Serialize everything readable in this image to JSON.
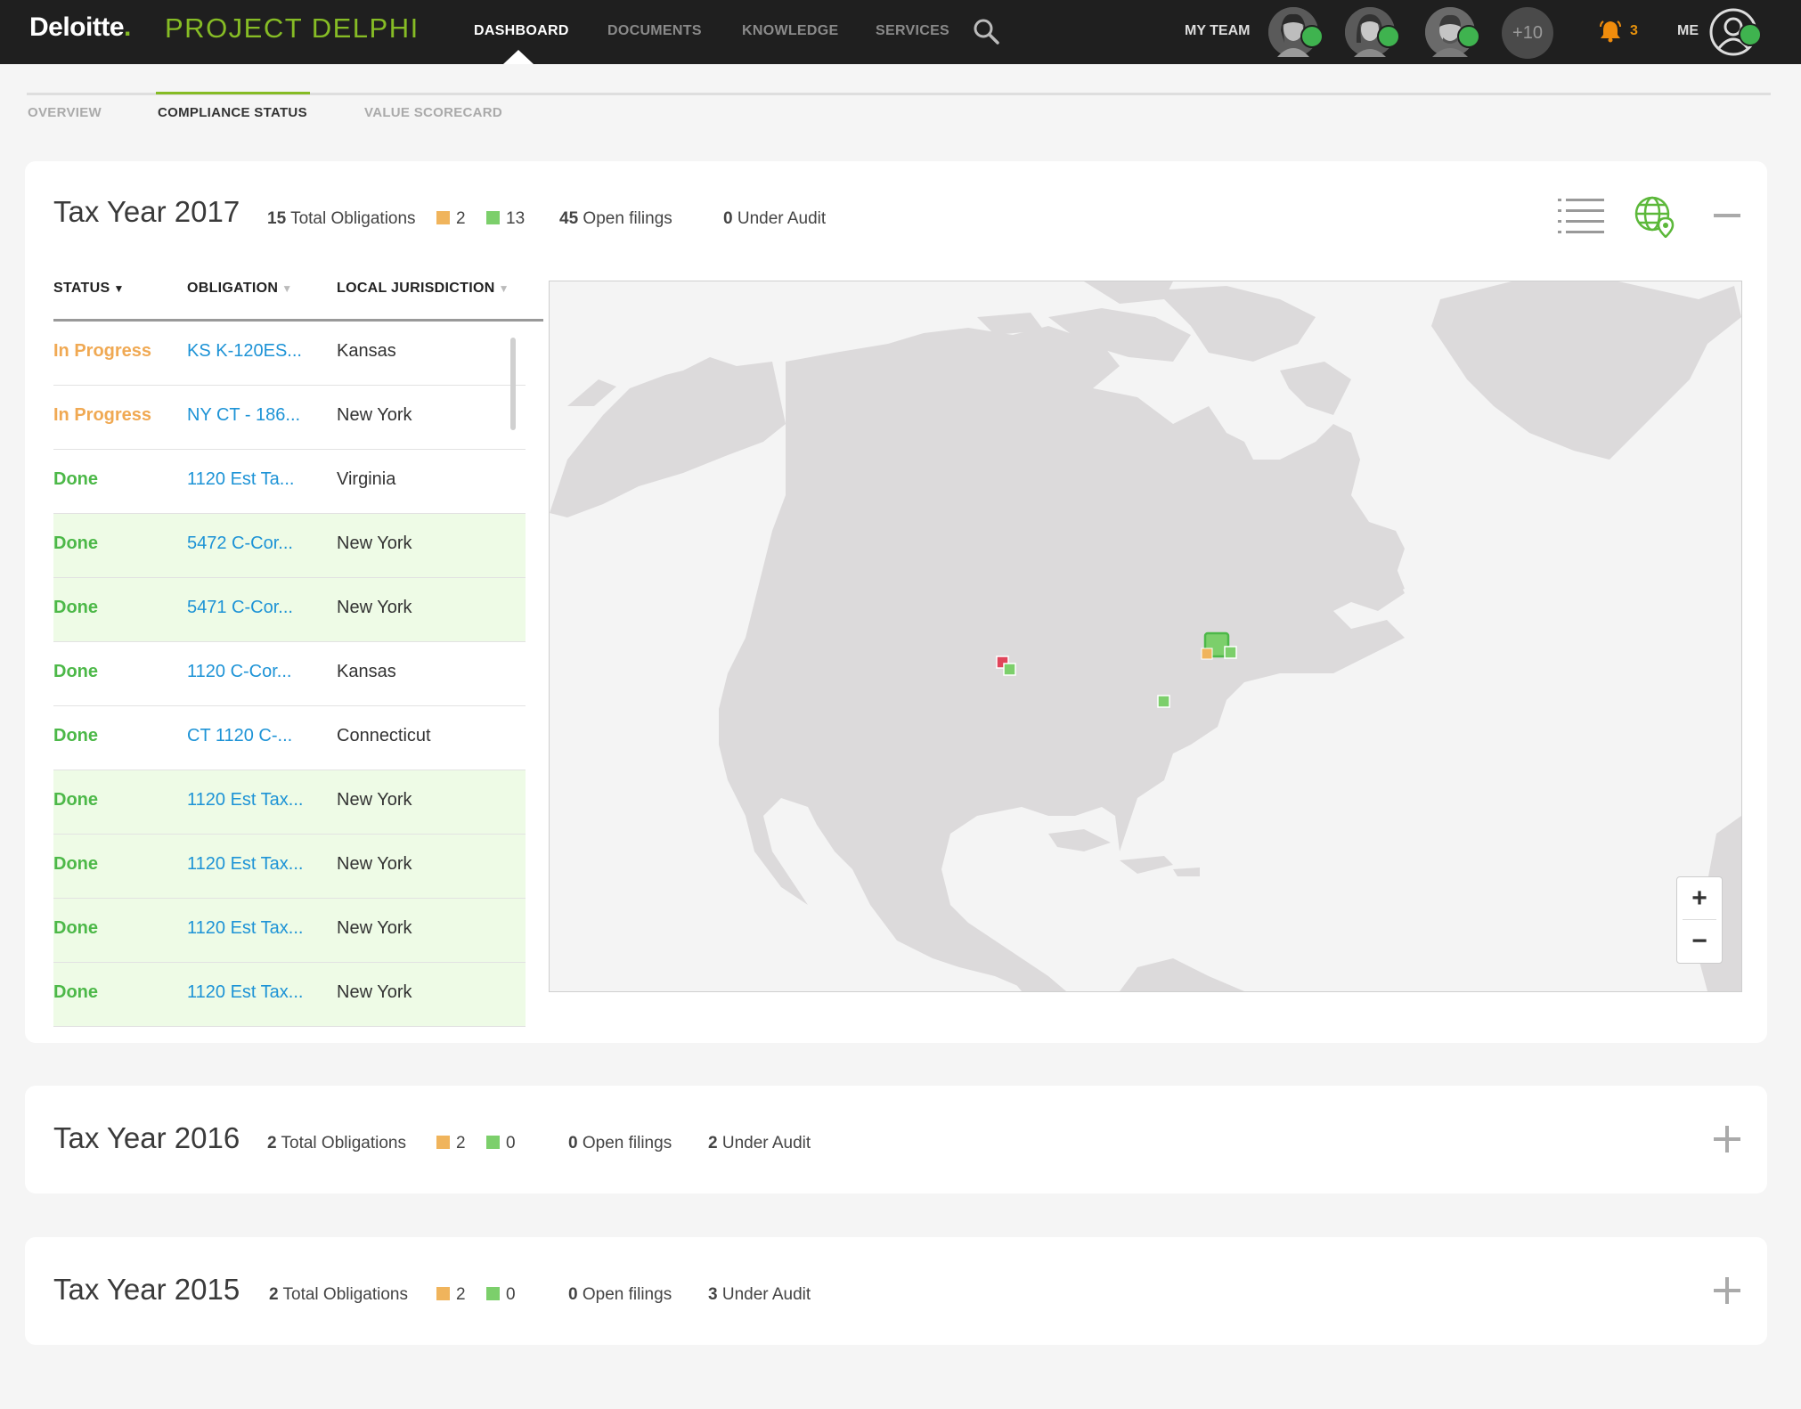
{
  "brand": {
    "name": "Deloitte",
    "dot": ".",
    "project": "PROJECT DELPHI"
  },
  "nav": {
    "items": [
      "DASHBOARD",
      "DOCUMENTS",
      "KNOWLEDGE",
      "SERVICES"
    ],
    "active": "DASHBOARD"
  },
  "team": {
    "label": "MY TEAM",
    "more": "+10"
  },
  "notifications": {
    "count": "3"
  },
  "me": {
    "label": "ME"
  },
  "subtabs": {
    "items": [
      "OVERVIEW",
      "COMPLIANCE STATUS",
      "VALUE SCORECARD"
    ],
    "active": "COMPLIANCE STATUS"
  },
  "years": [
    {
      "title": "Tax Year 2017",
      "total": "15",
      "total_label": "Total Obligations",
      "orange": "2",
      "green": "13",
      "open": "45",
      "open_label": "Open filings",
      "audit": "0",
      "audit_label": "Under Audit",
      "expanded": true
    },
    {
      "title": "Tax Year 2016",
      "total": "2",
      "total_label": "Total Obligations",
      "orange": "2",
      "green": "0",
      "open": "0",
      "open_label": "Open filings",
      "audit": "2",
      "audit_label": "Under Audit",
      "expanded": false
    },
    {
      "title": "Tax Year 2015",
      "total": "2",
      "total_label": "Total Obligations",
      "orange": "2",
      "green": "0",
      "open": "0",
      "open_label": "Open filings",
      "audit": "3",
      "audit_label": "Under Audit",
      "expanded": false
    }
  ],
  "table": {
    "headers": [
      "STATUS",
      "OBLIGATION",
      "LOCAL JURISDICTION"
    ],
    "rows": [
      {
        "status": "In Progress",
        "obligation": "KS K-120ES...",
        "jurisdiction": "Kansas",
        "highlight": false
      },
      {
        "status": "In Progress",
        "obligation": "NY CT - 186...",
        "jurisdiction": "New York",
        "highlight": false
      },
      {
        "status": "Done",
        "obligation": "1120 Est Ta...",
        "jurisdiction": "Virginia",
        "highlight": false
      },
      {
        "status": "Done",
        "obligation": "5472 C-Cor...",
        "jurisdiction": "New York",
        "highlight": true
      },
      {
        "status": "Done",
        "obligation": "5471 C-Cor...",
        "jurisdiction": "New York",
        "highlight": true
      },
      {
        "status": "Done",
        "obligation": "1120 C-Cor...",
        "jurisdiction": "Kansas",
        "highlight": false
      },
      {
        "status": "Done",
        "obligation": "CT 1120 C-...",
        "jurisdiction": "Connecticut",
        "highlight": false
      },
      {
        "status": "Done",
        "obligation": "1120 Est Tax...",
        "jurisdiction": "New York",
        "highlight": true
      },
      {
        "status": "Done",
        "obligation": "1120 Est Tax...",
        "jurisdiction": "New York",
        "highlight": true
      },
      {
        "status": "Done",
        "obligation": "1120 Est Tax...",
        "jurisdiction": "New York",
        "highlight": true
      },
      {
        "status": "Done",
        "obligation": "1120 Est Tax...",
        "jurisdiction": "New York",
        "highlight": true
      }
    ]
  },
  "map": {
    "zoom_in": "+",
    "zoom_out": "−",
    "markers": [
      {
        "state": "Kansas",
        "color": "#e0445a"
      },
      {
        "state": "Kansas",
        "color": "#7ccf6b"
      },
      {
        "state": "New York",
        "color": "#7ccf6b"
      },
      {
        "state": "New York",
        "color": "#f0b45c"
      },
      {
        "state": "Connecticut",
        "color": "#7ccf6b"
      },
      {
        "state": "Virginia",
        "color": "#7ccf6b"
      }
    ]
  },
  "colors": {
    "brand_green": "#86bc25",
    "progress": "#f0a953",
    "done": "#4cb848",
    "link": "#1d93d6"
  }
}
